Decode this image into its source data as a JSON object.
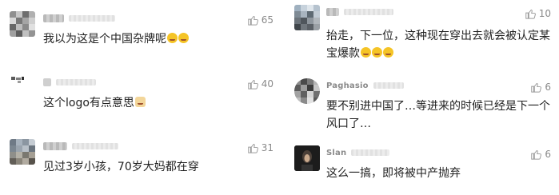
{
  "comments_left": [
    {
      "text": "我以为这是个中国杂牌呢",
      "emoji_icons": [
        "grin-sweat-icon",
        "grin-sweat-icon"
      ],
      "likes": "65"
    },
    {
      "text": "这个logo有点意思",
      "emoji_icons": [
        "cat-face-icon"
      ],
      "likes": "40"
    },
    {
      "text": "见过3岁小孩，70岁大妈都在穿",
      "emoji_icons": [],
      "likes": "31"
    }
  ],
  "comments_right": [
    {
      "name": "",
      "text": "抬走，下一位，这种现在穿出去就会被认定某宝爆款",
      "emoji_icons": [
        "thinking-face-icon",
        "thinking-face-icon",
        "thinking-face-icon"
      ],
      "likes": "10"
    },
    {
      "name": "Paghasio",
      "text": "要不别进中国了…等进来的时候已经是下一个风口了…",
      "emoji_icons": [],
      "likes": "6"
    },
    {
      "name": "Slan",
      "text": "这么一搞，即将被中产抛弃",
      "emoji_icons": [],
      "likes": "6"
    }
  ],
  "colors": {
    "text": "#222222",
    "muted": "#8a8a8a",
    "emoji": "#f5c426"
  }
}
